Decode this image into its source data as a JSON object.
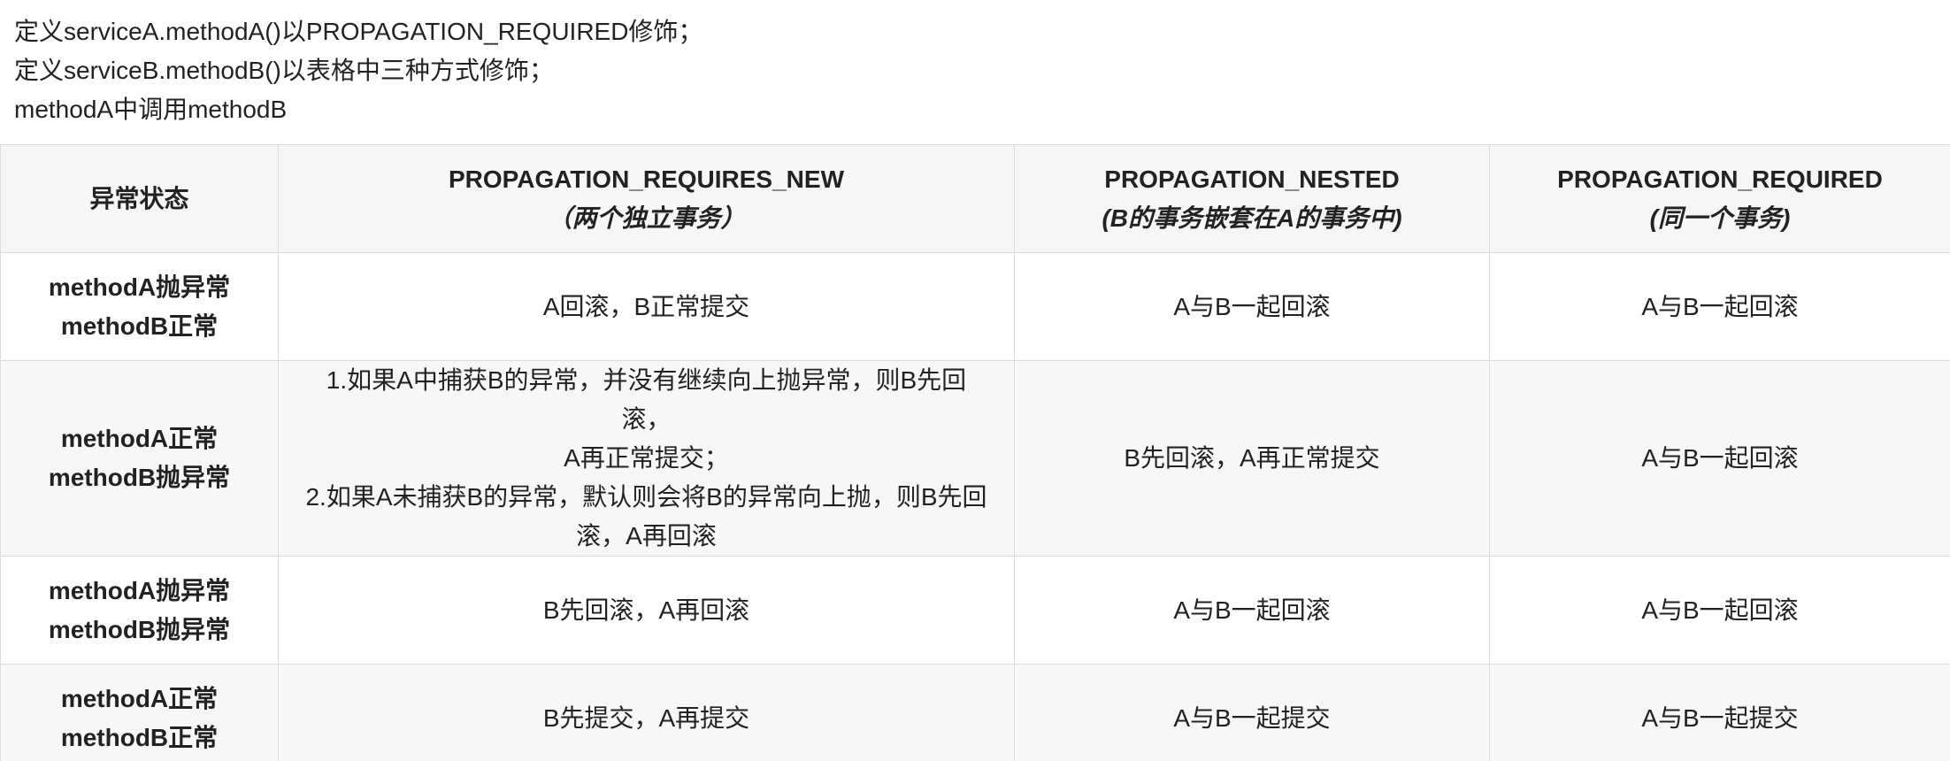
{
  "intro": {
    "line1": "定义serviceA.methodA()以PROPAGATION_REQUIRED修饰；",
    "line2": "定义serviceB.methodB()以表格中三种方式修饰；",
    "line3": "methodA中调用methodB"
  },
  "table": {
    "header": {
      "state": "异常状态",
      "columns": [
        {
          "name": "PROPAGATION_REQUIRES_NEW",
          "note": "（两个独立事务）"
        },
        {
          "name": "PROPAGATION_NESTED",
          "note": "(B的事务嵌套在A的事务中)"
        },
        {
          "name": "PROPAGATION_REQUIRED",
          "note": "(同一个事务)"
        }
      ]
    },
    "rows": [
      {
        "state_line1": "methodA抛异常",
        "state_line2": "methodB正常",
        "requires_new": "A回滚，B正常提交",
        "nested": "A与B一起回滚",
        "required": "A与B一起回滚"
      },
      {
        "state_line1": "methodA正常",
        "state_line2": "methodB抛异常",
        "requires_new_lines": [
          "1.如果A中捕获B的异常，并没有继续向上抛异常，则B先回滚，",
          "A再正常提交；",
          "2.如果A未捕获B的异常，默认则会将B的异常向上抛，则B先回",
          "滚，A再回滚"
        ],
        "nested": "B先回滚，A再正常提交",
        "required": "A与B一起回滚"
      },
      {
        "state_line1": "methodA抛异常",
        "state_line2": "methodB抛异常",
        "requires_new": "B先回滚，A再回滚",
        "nested": "A与B一起回滚",
        "required": "A与B一起回滚"
      },
      {
        "state_line1": "methodA正常",
        "state_line2": "methodB正常",
        "requires_new": "B先提交，A再提交",
        "nested": "A与B一起提交",
        "required": "A与B一起提交"
      }
    ]
  }
}
